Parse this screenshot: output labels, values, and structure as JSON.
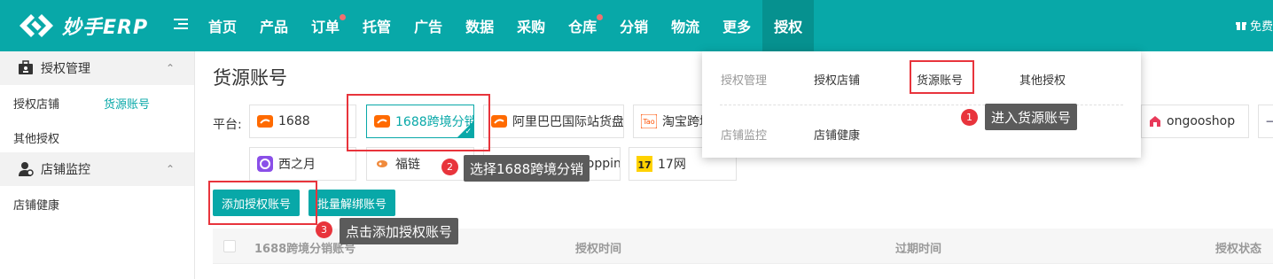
{
  "app": {
    "logo_text": "妙手ERP"
  },
  "nav": {
    "items": [
      {
        "label": "首页",
        "dot": false
      },
      {
        "label": "产品",
        "dot": false
      },
      {
        "label": "订单",
        "dot": true
      },
      {
        "label": "托管",
        "dot": false
      },
      {
        "label": "广告",
        "dot": false
      },
      {
        "label": "数据",
        "dot": false
      },
      {
        "label": "采购",
        "dot": false
      },
      {
        "label": "仓库",
        "dot": true
      },
      {
        "label": "分销",
        "dot": false
      },
      {
        "label": "物流",
        "dot": false
      },
      {
        "label": "更多",
        "dot": false
      },
      {
        "label": "授权",
        "dot": false,
        "active": true
      }
    ],
    "right_text": "免费"
  },
  "sidebar": {
    "groups": [
      {
        "label": "授权管理",
        "items": [
          "授权店铺",
          "货源账号",
          "其他授权"
        ]
      },
      {
        "label": "店铺监控",
        "items": [
          "店铺健康"
        ]
      }
    ]
  },
  "main": {
    "title": "货源账号",
    "platform_label": "平台:",
    "platforms_row1": [
      "1688",
      "1688跨境分销",
      "阿里巴巴国际站货盘",
      "淘宝跨境"
    ],
    "platforms_row1_right": [
      "ongooshop"
    ],
    "platforms_row2": [
      "西之月",
      "福链",
      "Shopping",
      "17网"
    ],
    "buttons": {
      "add": "添加授权账号",
      "batch_unbind": "批量解绑账号"
    },
    "table_headers": [
      "1688跨境分销账号",
      "授权时间",
      "过期时间",
      "授权状态"
    ]
  },
  "dropdown": {
    "section1_label": "授权管理",
    "section1_links": [
      "授权店铺",
      "货源账号",
      "其他授权"
    ],
    "section2_label": "店铺监控",
    "section2_links": [
      "店铺健康"
    ]
  },
  "annotations": [
    {
      "num": "1",
      "text": "进入货源账号"
    },
    {
      "num": "2",
      "text": "选择1688跨境分销"
    },
    {
      "num": "3",
      "text": "点击添加授权账号"
    }
  ],
  "colors": {
    "brand": "#08a8a8",
    "highlight": "#e8343c",
    "tooltip": "#5b5b5b"
  }
}
